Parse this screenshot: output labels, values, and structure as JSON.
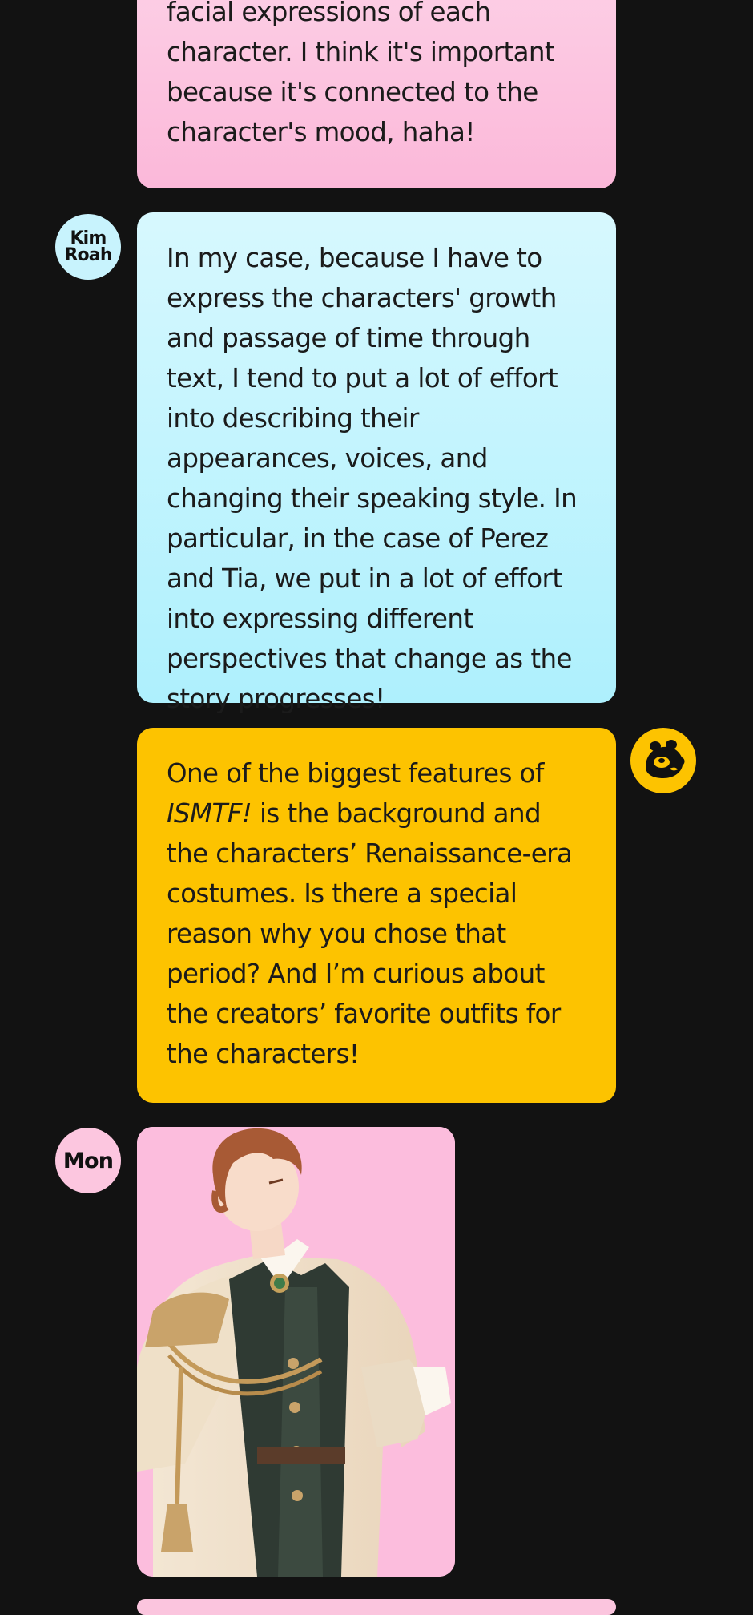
{
  "messages": [
    {
      "id": "m1",
      "text": "facial expressions of each character. I think it's important because it's connected to the character's mood, haha!"
    },
    {
      "id": "m2",
      "speaker": "Kim Roah",
      "speaker_lines": [
        "Kim",
        "Roah"
      ],
      "text": "In my case, because I have to express the characters' growth and passage of time through text, I tend to put a lot of effort into describing their appearances, voices, and changing their speaking style. In particular, in the case of Perez and Tia, we put in a lot of effort into expressing different perspectives that change as the story progresses!"
    },
    {
      "id": "m3",
      "speaker_icon": "bear-mascot-icon",
      "title_italic": "ISMTF!",
      "text_rest": " is the background and the characters’ Renaissance-era costumes. Is there a special reason why you chose that period? And I’m curious about the creators’ favorite outfits for the characters!",
      "text_before": "One of the biggest features of "
    },
    {
      "id": "m4",
      "speaker": "Mon",
      "image": "character-illustration"
    }
  ],
  "colors": {
    "background": "#121212",
    "pink_bubble": "#fbb8d9",
    "cyan_bubble": "#aef0fd",
    "yellow_bubble": "#fdc300"
  }
}
